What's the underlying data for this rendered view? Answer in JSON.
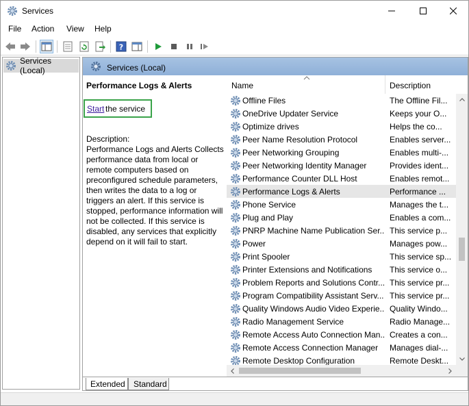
{
  "window": {
    "title": "Services"
  },
  "menu": [
    "File",
    "Action",
    "View",
    "Help"
  ],
  "toolbar": {
    "icons": [
      "back-arrow-icon",
      "forward-arrow-icon",
      "console-tree-icon",
      "properties-icon",
      "refresh-icon",
      "export-list-icon",
      "help-icon",
      "action-pane-icon",
      "play-icon",
      "stop-icon",
      "pause-icon",
      "restart-icon"
    ]
  },
  "tree": {
    "root_label": "Services (Local)"
  },
  "header": {
    "label": "Services (Local)"
  },
  "details": {
    "service_title": "Performance Logs & Alerts",
    "start_link": "Start",
    "start_rest": " the service",
    "description_label": "Description:",
    "description_text": "Performance Logs and Alerts Collects performance data from local or remote computers based on preconfigured schedule parameters, then writes the data to a log or triggers an alert. If this service is stopped, performance information will not be collected. If this service is disabled, any services that explicitly depend on it will fail to start."
  },
  "list": {
    "columns": {
      "name": "Name",
      "description": "Description"
    },
    "selected_index": 7,
    "rows": [
      {
        "name": "Offline Files",
        "description": "The Offline Fil..."
      },
      {
        "name": "OneDrive Updater Service",
        "description": "Keeps your O..."
      },
      {
        "name": "Optimize drives",
        "description": "Helps the co..."
      },
      {
        "name": "Peer Name Resolution Protocol",
        "description": "Enables server..."
      },
      {
        "name": "Peer Networking Grouping",
        "description": "Enables multi-..."
      },
      {
        "name": "Peer Networking Identity Manager",
        "description": "Provides ident..."
      },
      {
        "name": "Performance Counter DLL Host",
        "description": "Enables remot..."
      },
      {
        "name": "Performance Logs & Alerts",
        "description": "Performance ..."
      },
      {
        "name": "Phone Service",
        "description": "Manages the t..."
      },
      {
        "name": "Plug and Play",
        "description": "Enables a com..."
      },
      {
        "name": "PNRP Machine Name Publication Ser...",
        "description": "This service p..."
      },
      {
        "name": "Power",
        "description": "Manages pow..."
      },
      {
        "name": "Print Spooler",
        "description": "This service sp..."
      },
      {
        "name": "Printer Extensions and Notifications",
        "description": "This service o..."
      },
      {
        "name": "Problem Reports and Solutions Contr...",
        "description": "This service pr..."
      },
      {
        "name": "Program Compatibility Assistant Serv...",
        "description": "This service pr..."
      },
      {
        "name": "Quality Windows Audio Video Experie...",
        "description": "Quality Windo..."
      },
      {
        "name": "Radio Management Service",
        "description": "Radio Manage..."
      },
      {
        "name": "Remote Access Auto Connection Man...",
        "description": "Creates a con..."
      },
      {
        "name": "Remote Access Connection Manager",
        "description": "Manages dial-..."
      },
      {
        "name": "Remote Desktop Configuration",
        "description": "Remote Deskt..."
      }
    ]
  },
  "tabs": [
    "Extended",
    "Standard"
  ]
}
